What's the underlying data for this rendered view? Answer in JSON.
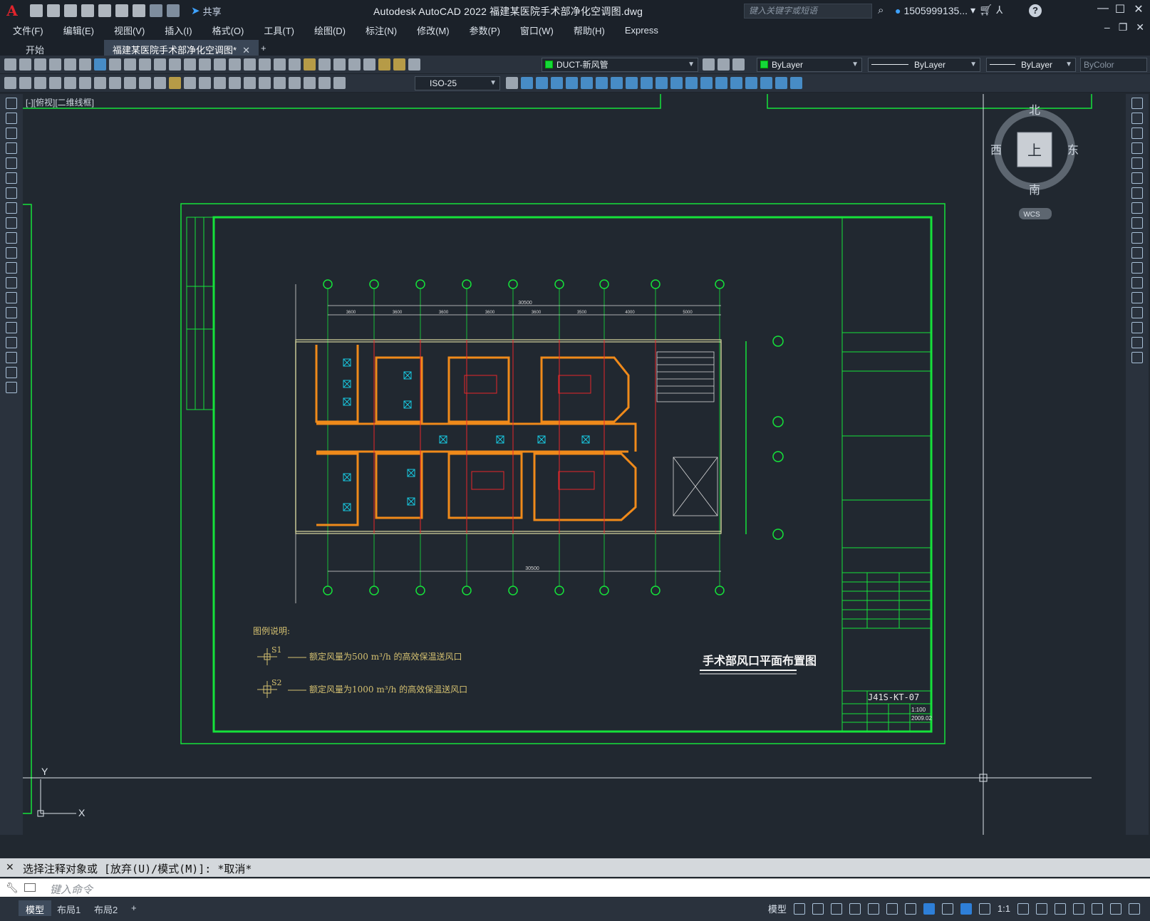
{
  "app": {
    "logo": "A",
    "title": "Autodesk AutoCAD 2022    福建某医院手术部净化空调图.dwg",
    "share_label": "共享",
    "search_placeholder": "键入关键字或短语",
    "user_label": "1505999135...",
    "window_controls": [
      "minimize-icon",
      "maximize-icon",
      "close-icon"
    ]
  },
  "menu": [
    "文件(F)",
    "编辑(E)",
    "视图(V)",
    "插入(I)",
    "格式(O)",
    "工具(T)",
    "绘图(D)",
    "标注(N)",
    "修改(M)",
    "参数(P)",
    "窗口(W)",
    "帮助(H)",
    "Express"
  ],
  "tabs": {
    "start": "开始",
    "active": "福建某医院手术部净化空调图*",
    "add": "+"
  },
  "toolbar": {
    "layer_name": "DUCT-新风管",
    "color": "ByLayer",
    "linetype": "ByLayer",
    "lineweight": "ByLayer",
    "plotstyle": "ByColor",
    "dim_style": "ISO-25"
  },
  "viewport": {
    "label": "[-][俯视][二维线框]",
    "viewcube": {
      "north": "北",
      "south": "南",
      "east": "东",
      "west": "西",
      "face": "上",
      "wcs": "WCS"
    },
    "ucs_x": "X",
    "ucs_y": "Y"
  },
  "drawing": {
    "title": "手术部风口平面布置图",
    "drawing_no": "J41S-KT-07",
    "scale": "1:100",
    "date": "2009.02",
    "legend_title": "图例说明:",
    "legend_items": [
      {
        "tag": "S1",
        "text": "额定风量为500 m³/h 的高效保温送风口"
      },
      {
        "tag": "S2",
        "text": "额定风量为1000 m³/h 的高效保温送风口"
      }
    ],
    "dim_total": "30500",
    "dims": [
      "3600",
      "3600",
      "3600",
      "3600",
      "3600",
      "3500",
      "4000",
      "5000"
    ]
  },
  "command": {
    "output": "选择注释对象或 [放弃(U)/模式(M)]: *取消*",
    "input_placeholder": "键入命令"
  },
  "layouts": [
    "模型",
    "布局1",
    "布局2"
  ],
  "status": {
    "model": "模型",
    "scale": "1:1"
  },
  "colors": {
    "frame_green": "#15e23a",
    "wall_orange": "#f08a1a",
    "axis_red": "#e8262a",
    "duct_cyan": "#18c8e0",
    "bg": "#212830"
  }
}
